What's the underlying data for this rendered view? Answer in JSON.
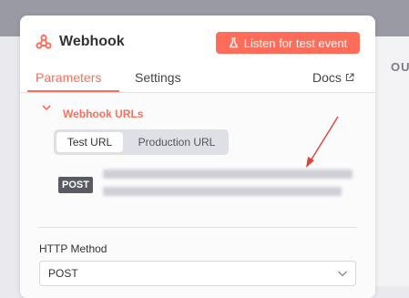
{
  "colors": {
    "accent": "#ff6d5a",
    "canvas_top": "#9a9aa4",
    "badge": "#5a5a62",
    "annotation_arrow": "#e0403a"
  },
  "background": {
    "output_label": "OU"
  },
  "node": {
    "title": "Webhook",
    "icon": "webhook-icon",
    "listen_button_label": "Listen for test event",
    "listen_button_icon": "flask-icon"
  },
  "tabs": {
    "parameters": "Parameters",
    "settings": "Settings",
    "docs": "Docs",
    "docs_icon": "external-link-icon",
    "active": "parameters"
  },
  "webhook_urls": {
    "section_title": "Webhook URLs",
    "toggle_icon": "chevron-down-icon",
    "test_url_tab": "Test URL",
    "production_url_tab": "Production URL",
    "active_url_tab": "test",
    "method_badge": "POST",
    "url_blurred": true
  },
  "http_method": {
    "label": "HTTP Method",
    "value": "POST",
    "dropdown_icon": "chevron-down-icon"
  }
}
